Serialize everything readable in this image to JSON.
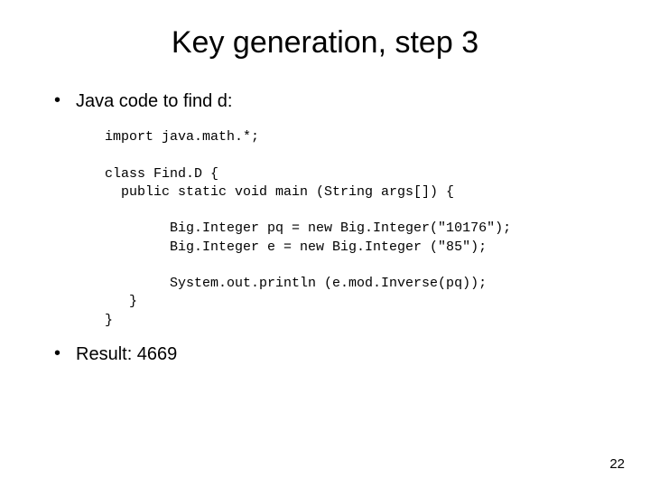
{
  "title": "Key generation, step 3",
  "bullet1": "Java code to find d:",
  "code": "import java.math.*;\n\nclass Find.D {\n  public static void main (String args[]) {\n\n        Big.Integer pq = new Big.Integer(\"10176\");\n        Big.Integer e = new Big.Integer (\"85\");\n\n        System.out.println (e.mod.Inverse(pq));\n   }\n}",
  "bullet2": "Result: 4669",
  "page_number": "22"
}
